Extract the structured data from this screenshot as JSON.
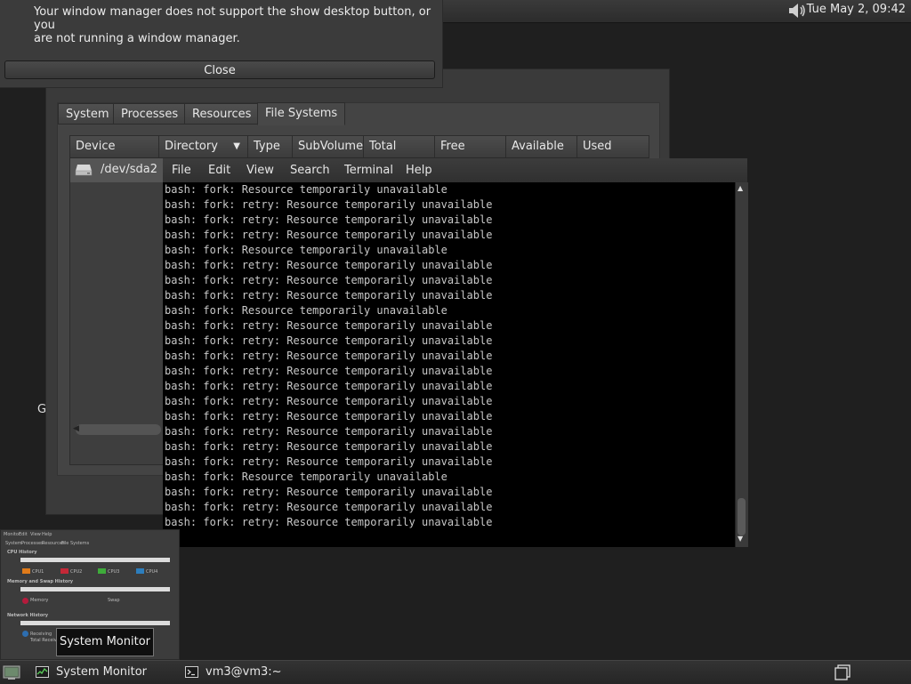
{
  "top_panel": {
    "clock": "Tue May  2, 09:42",
    "volume_icon": "speaker-icon"
  },
  "notification": {
    "message": "Your window manager does not support the show desktop button, or you\nare not running a window manager.",
    "close_label": "Close"
  },
  "system_monitor": {
    "tabs": [
      "System",
      "Processes",
      "Resources",
      "File Systems"
    ],
    "active_tab": "File Systems",
    "columns": [
      "Device",
      "Directory",
      "Type",
      "SubVolume",
      "Total",
      "Free",
      "Available",
      "Used"
    ],
    "rows": [
      {
        "device": "/dev/sda2"
      }
    ]
  },
  "terminal": {
    "menu": [
      "File",
      "Edit",
      "View",
      "Search",
      "Terminal",
      "Help"
    ],
    "lines": [
      "bash: fork: Resource temporarily unavailable",
      "bash: fork: retry: Resource temporarily unavailable",
      "bash: fork: retry: Resource temporarily unavailable",
      "bash: fork: retry: Resource temporarily unavailable",
      "bash: fork: Resource temporarily unavailable",
      "bash: fork: retry: Resource temporarily unavailable",
      "bash: fork: retry: Resource temporarily unavailable",
      "bash: fork: retry: Resource temporarily unavailable",
      "bash: fork: Resource temporarily unavailable",
      "bash: fork: retry: Resource temporarily unavailable",
      "bash: fork: retry: Resource temporarily unavailable",
      "bash: fork: retry: Resource temporarily unavailable",
      "bash: fork: retry: Resource temporarily unavailable",
      "bash: fork: retry: Resource temporarily unavailable",
      "bash: fork: retry: Resource temporarily unavailable",
      "bash: fork: retry: Resource temporarily unavailable",
      "bash: fork: retry: Resource temporarily unavailable",
      "bash: fork: retry: Resource temporarily unavailable",
      "bash: fork: retry: Resource temporarily unavailable",
      "bash: fork: Resource temporarily unavailable",
      "bash: fork: retry: Resource temporarily unavailable",
      "bash: fork: retry: Resource temporarily unavailable",
      "bash: fork: retry: Resource temporarily unavailable"
    ]
  },
  "stray_text": "G",
  "thumbnail": {
    "menu": [
      "Monitor",
      "Edit",
      "View",
      "Help"
    ],
    "tabs": [
      "System",
      "Processes",
      "Resources",
      "File Systems"
    ],
    "sections": [
      "CPU History",
      "Memory and Swap History",
      "Network History"
    ],
    "cpu_legend": [
      "CPU1",
      "CPU2",
      "CPU3",
      "CPU4"
    ],
    "memory_legend": [
      "Memory",
      "Swap"
    ],
    "network_legend": [
      "Receiving",
      "Total Received"
    ]
  },
  "tooltip": "System Monitor",
  "taskbar": {
    "tasks": [
      "System Monitor",
      "vm3@vm3:~"
    ]
  }
}
